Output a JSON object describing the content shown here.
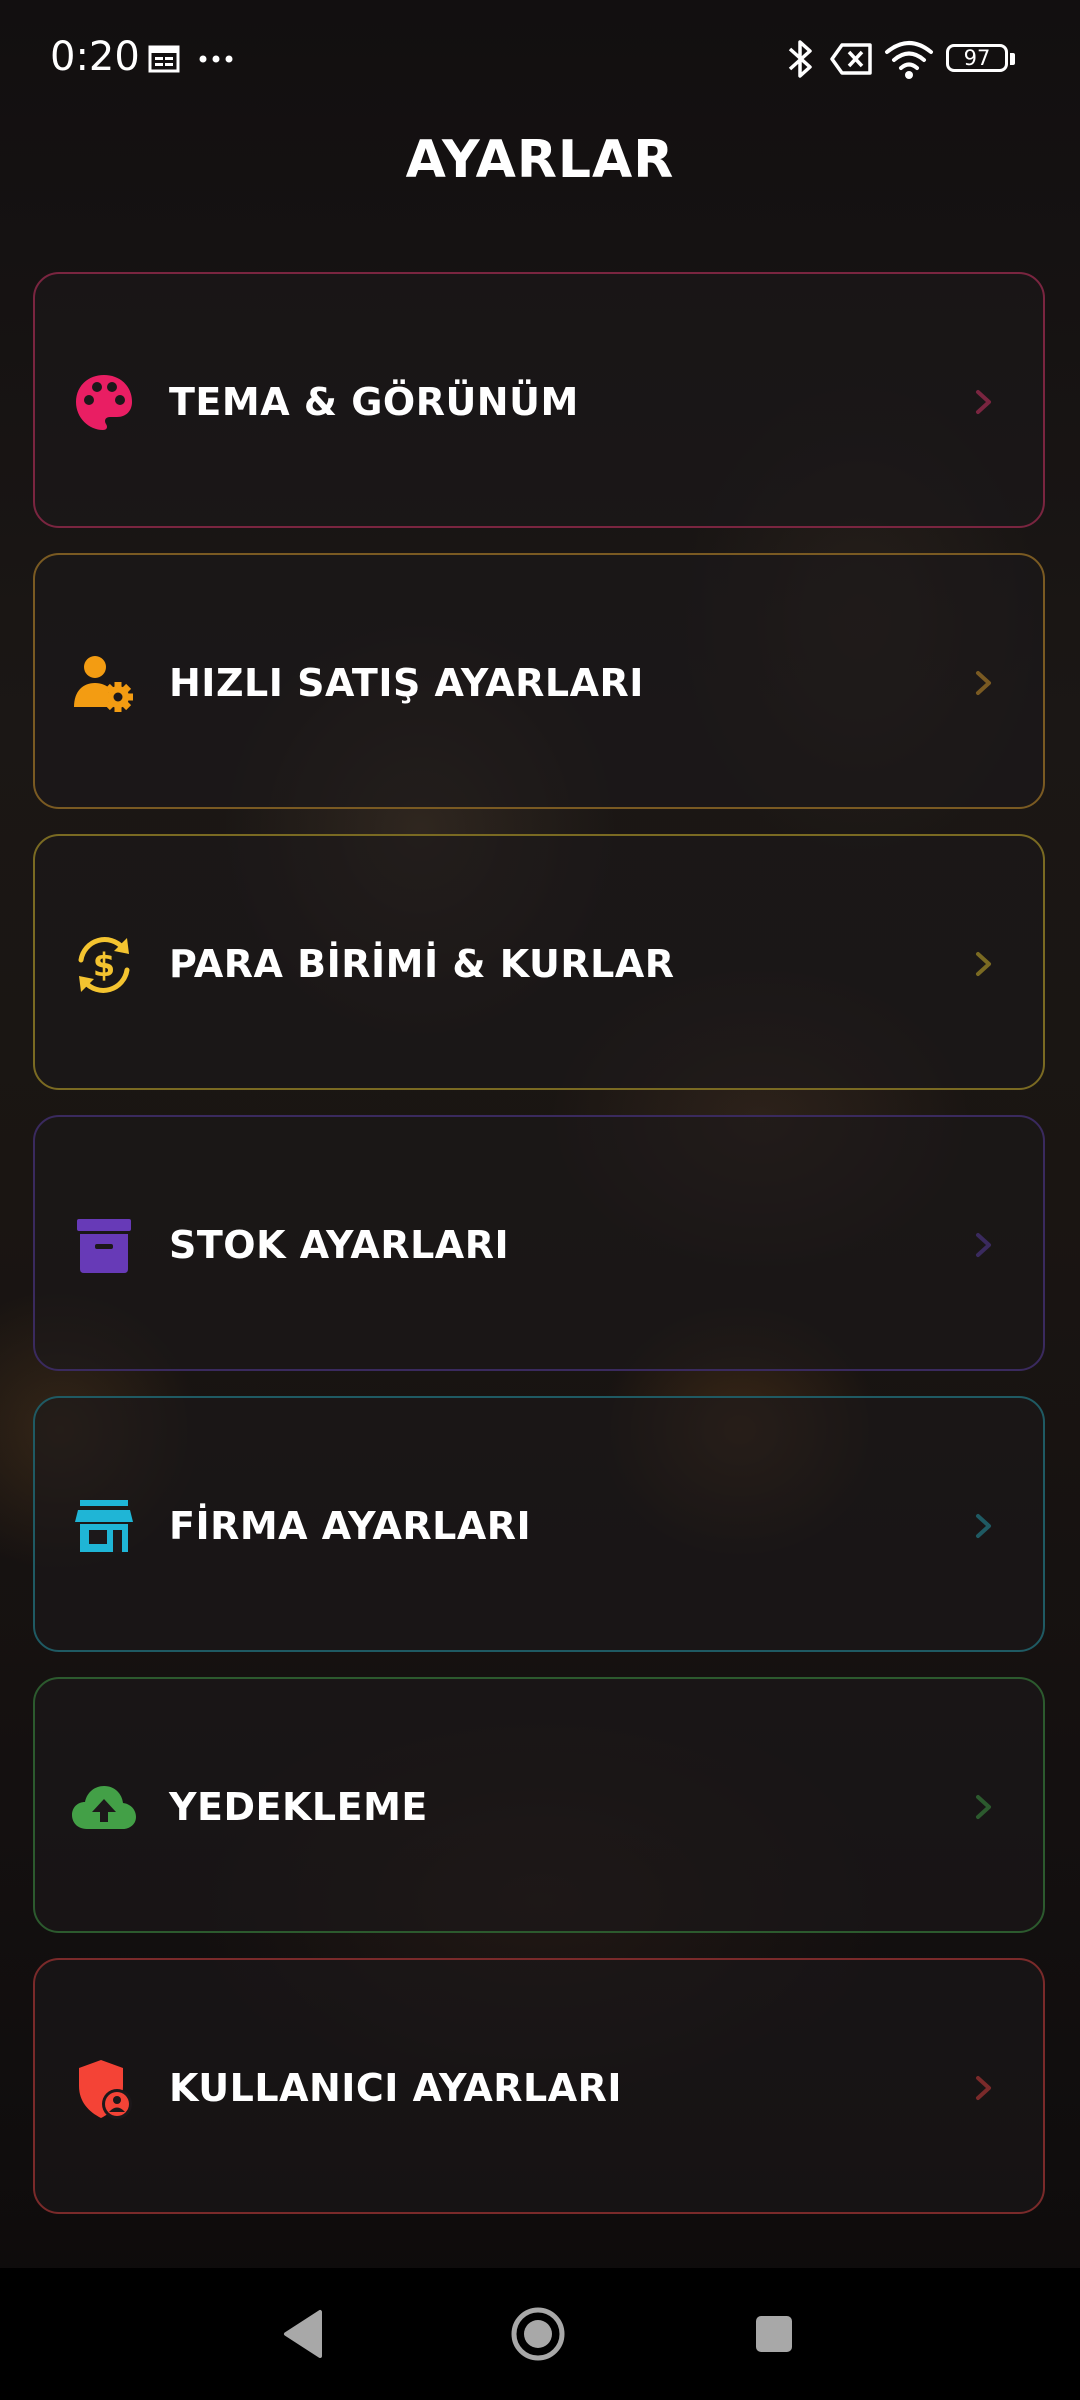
{
  "status_bar": {
    "time": "0:20",
    "battery": "97",
    "icons": [
      "calendar-icon",
      "more-dots-icon",
      "bluetooth-icon",
      "sim-none-icon",
      "wifi-icon",
      "battery-icon"
    ]
  },
  "header": {
    "title": "AYARLAR"
  },
  "menu": {
    "items": [
      {
        "label": "TEMA & GÖRÜNÜM",
        "icon": "palette-icon",
        "accent": "#e91e63",
        "border": "#7a2540"
      },
      {
        "label": "HIZLI SATIŞ AYARLARI",
        "icon": "user-gear-icon",
        "accent": "#f39c12",
        "border": "#7a5a22"
      },
      {
        "label": "PARA BİRİMİ & KURLAR",
        "icon": "currency-exchange-icon",
        "accent": "#f4c430",
        "border": "#7a6a22"
      },
      {
        "label": "STOK AYARLARI",
        "icon": "archive-box-icon",
        "accent": "#673ab7",
        "border": "#3a2a5e"
      },
      {
        "label": "FİRMA AYARLARI",
        "icon": "storefront-icon",
        "accent": "#1fb5d6",
        "border": "#1f5a63"
      },
      {
        "label": "YEDEKLEME",
        "icon": "cloud-upload-icon",
        "accent": "#43a047",
        "border": "#2c5a2e"
      },
      {
        "label": "KULLANICI AYARLARI",
        "icon": "shield-user-icon",
        "accent": "#f44336",
        "border": "#7a2a2a"
      }
    ]
  },
  "nav": {
    "icons": [
      "back-icon",
      "home-icon",
      "recents-icon"
    ]
  }
}
